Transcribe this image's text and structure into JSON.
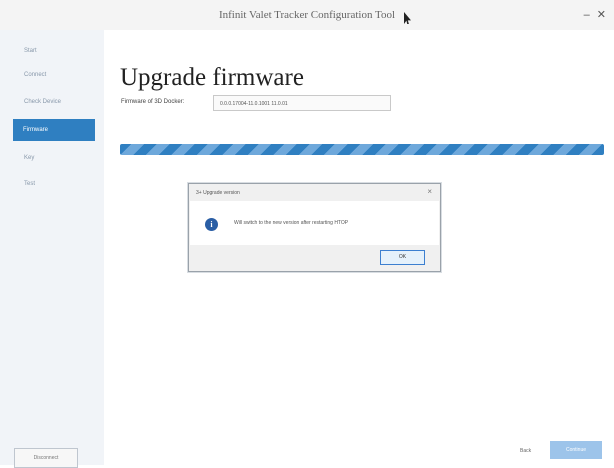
{
  "window": {
    "title": "Infinit Valet Tracker Configuration Tool",
    "controls": "– ✕"
  },
  "sidebar": {
    "items": [
      {
        "label": "Start"
      },
      {
        "label": "Connect"
      },
      {
        "label": "Check Device"
      },
      {
        "label": "Firmware"
      },
      {
        "label": "Key"
      },
      {
        "label": "Test"
      }
    ],
    "bottom_button_label": "Disconnect"
  },
  "main": {
    "heading": "Upgrade firmware",
    "firmware_label": "Firmware of 3D Docker:",
    "firmware_value": "0.0.0.17004-11.0.1001 11.0.01",
    "progress": 1.0
  },
  "dialog": {
    "title": "3+ Upgrade version",
    "close_label": "×",
    "info_icon": "i",
    "message": "Will switch to the new version after restarting HTOP",
    "ok_label": "OK"
  },
  "footer": {
    "back_label": "Back",
    "next_label": "Continue"
  },
  "colors": {
    "accent": "#2f7fc1",
    "sidebar_bg": "#f1f4f8",
    "dialog_bg": "#f0f0f0"
  }
}
